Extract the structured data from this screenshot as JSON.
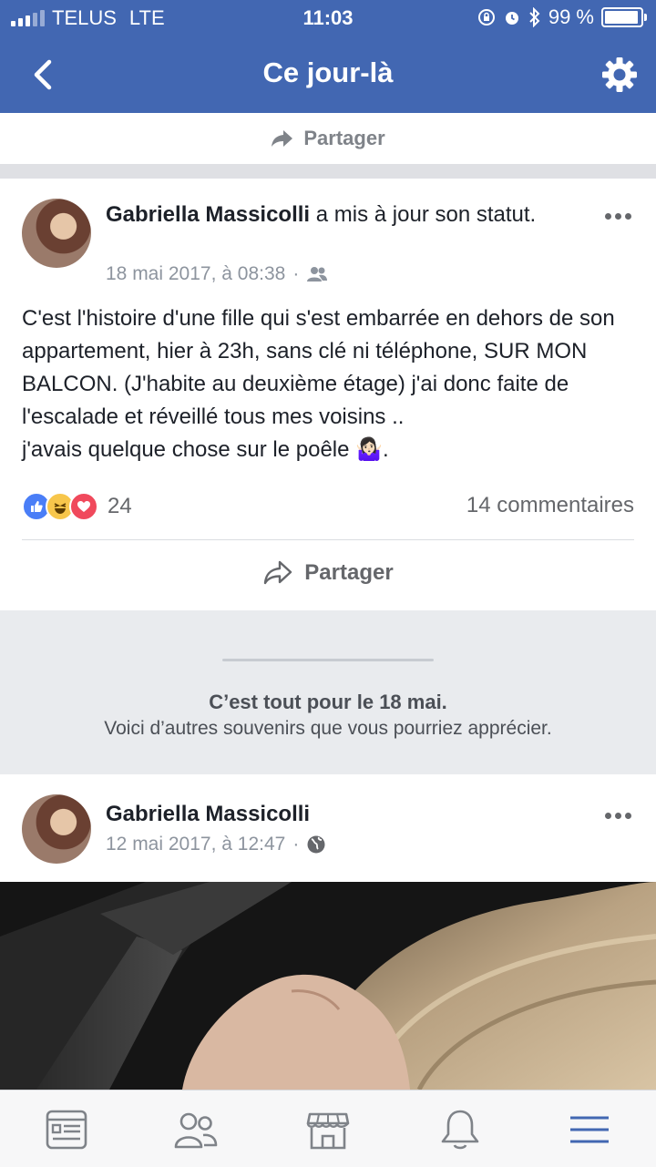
{
  "status_bar": {
    "carrier": "TELUS",
    "network": "LTE",
    "time": "11:03",
    "battery_percent": "99 %",
    "battery_level": 0.99
  },
  "nav": {
    "title": "Ce jour-là"
  },
  "top_share": {
    "label": "Partager"
  },
  "post1": {
    "author_name": "Gabriella Massicolli",
    "action": "a mis à jour son statut.",
    "date": "18 mai 2017, à 08:38",
    "audience_icon": "friends-icon",
    "text": "C'est l'histoire d'une fille qui s'est embarrée en dehors de son appartement, hier à 23h, sans clé ni téléphone, SUR MON BALCON. (J'habite au deuxième étage) j'ai donc faite de l'escalade et réveillé tous mes voisins ..",
    "text2": "j'avais quelque chose sur le poêle",
    "emoji": "🤷🏻‍♀️",
    "text_end": ".",
    "reaction_count": "24",
    "comments": "14 commentaires",
    "share_label": "Partager"
  },
  "banner": {
    "title": "C’est tout pour le 18 mai.",
    "subtitle": "Voici d’autres souvenirs que vous pourriez apprécier."
  },
  "post2": {
    "author_name": "Gabriella Massicolli",
    "date": "12 mai 2017, à 12:47",
    "audience_icon": "globe-icon"
  },
  "tabs": [
    {
      "icon": "news-feed-icon",
      "active": false
    },
    {
      "icon": "friends-icon",
      "active": false
    },
    {
      "icon": "marketplace-icon",
      "active": false
    },
    {
      "icon": "notifications-bell-icon",
      "active": false
    },
    {
      "icon": "menu-icon",
      "active": true
    }
  ],
  "colors": {
    "brand": "#4267b2",
    "active_tab": "#4267b2",
    "inactive_tab": "#7f8389"
  }
}
